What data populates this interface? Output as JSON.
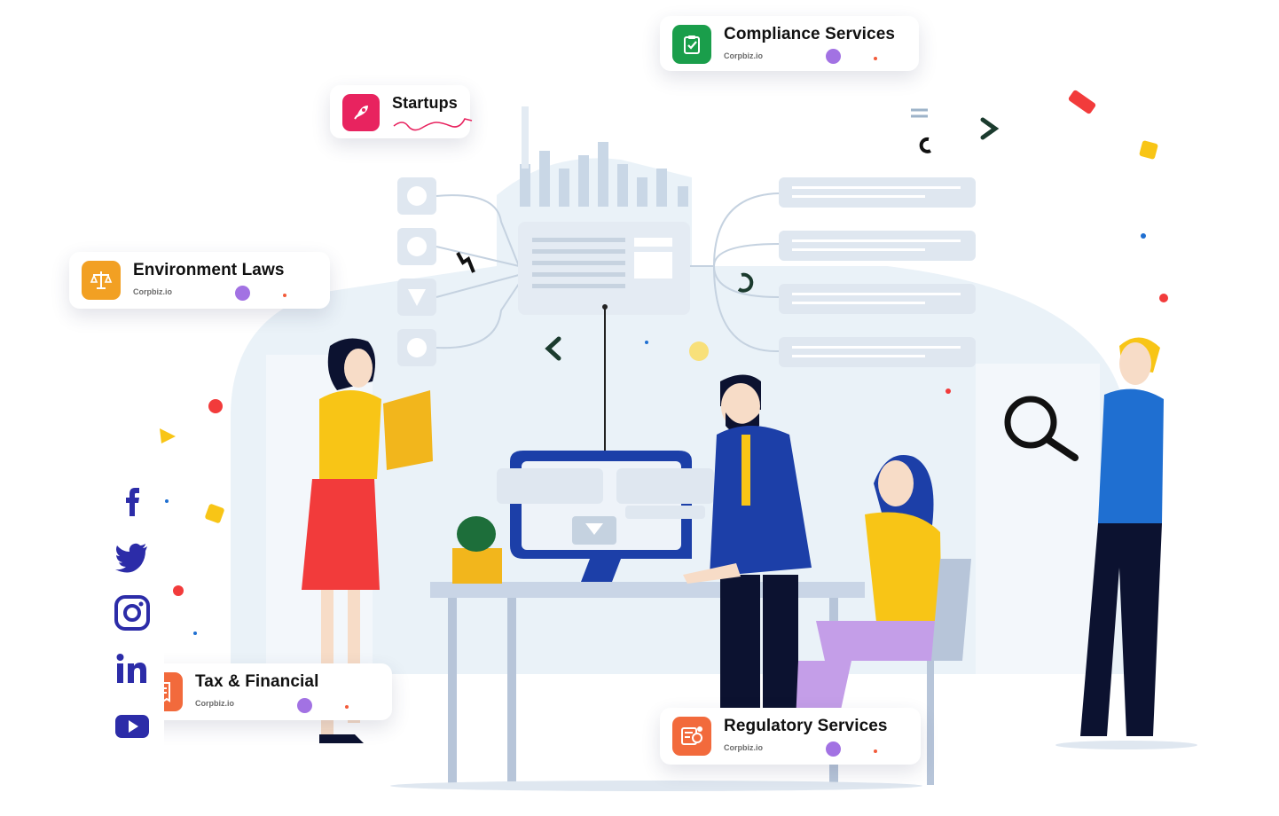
{
  "cards": [
    {
      "id": "compliance",
      "title": "Compliance Services",
      "subtitle": "Corpbiz.io",
      "icon": "clipboard-check-icon",
      "icon_color": "#1a9e4b"
    },
    {
      "id": "startups",
      "title": "Startups",
      "icon": "rocket-icon",
      "icon_color": "#e8235f"
    },
    {
      "id": "environment",
      "title": "Environment Laws",
      "subtitle": "Corpbiz.io",
      "icon": "scales-icon",
      "icon_color": "#f2a023"
    },
    {
      "id": "tax",
      "title": "Tax & Financial",
      "subtitle": "Corpbiz.io",
      "icon": "receipt-icon",
      "icon_color": "#f26a3c"
    },
    {
      "id": "regulatory",
      "title": "Regulatory Services",
      "subtitle": "Corpbiz.io",
      "icon": "certificate-icon",
      "icon_color": "#f26a3c"
    }
  ],
  "social": [
    {
      "name": "facebook",
      "icon": "facebook-icon"
    },
    {
      "name": "twitter",
      "icon": "twitter-icon"
    },
    {
      "name": "instagram",
      "icon": "instagram-icon"
    },
    {
      "name": "linkedin",
      "icon": "linkedin-icon"
    },
    {
      "name": "youtube",
      "icon": "youtube-icon"
    }
  ],
  "colors": {
    "social": "#2c2ca8",
    "accent_purple": "#a272e3",
    "accent_red": "#f25b3a"
  }
}
